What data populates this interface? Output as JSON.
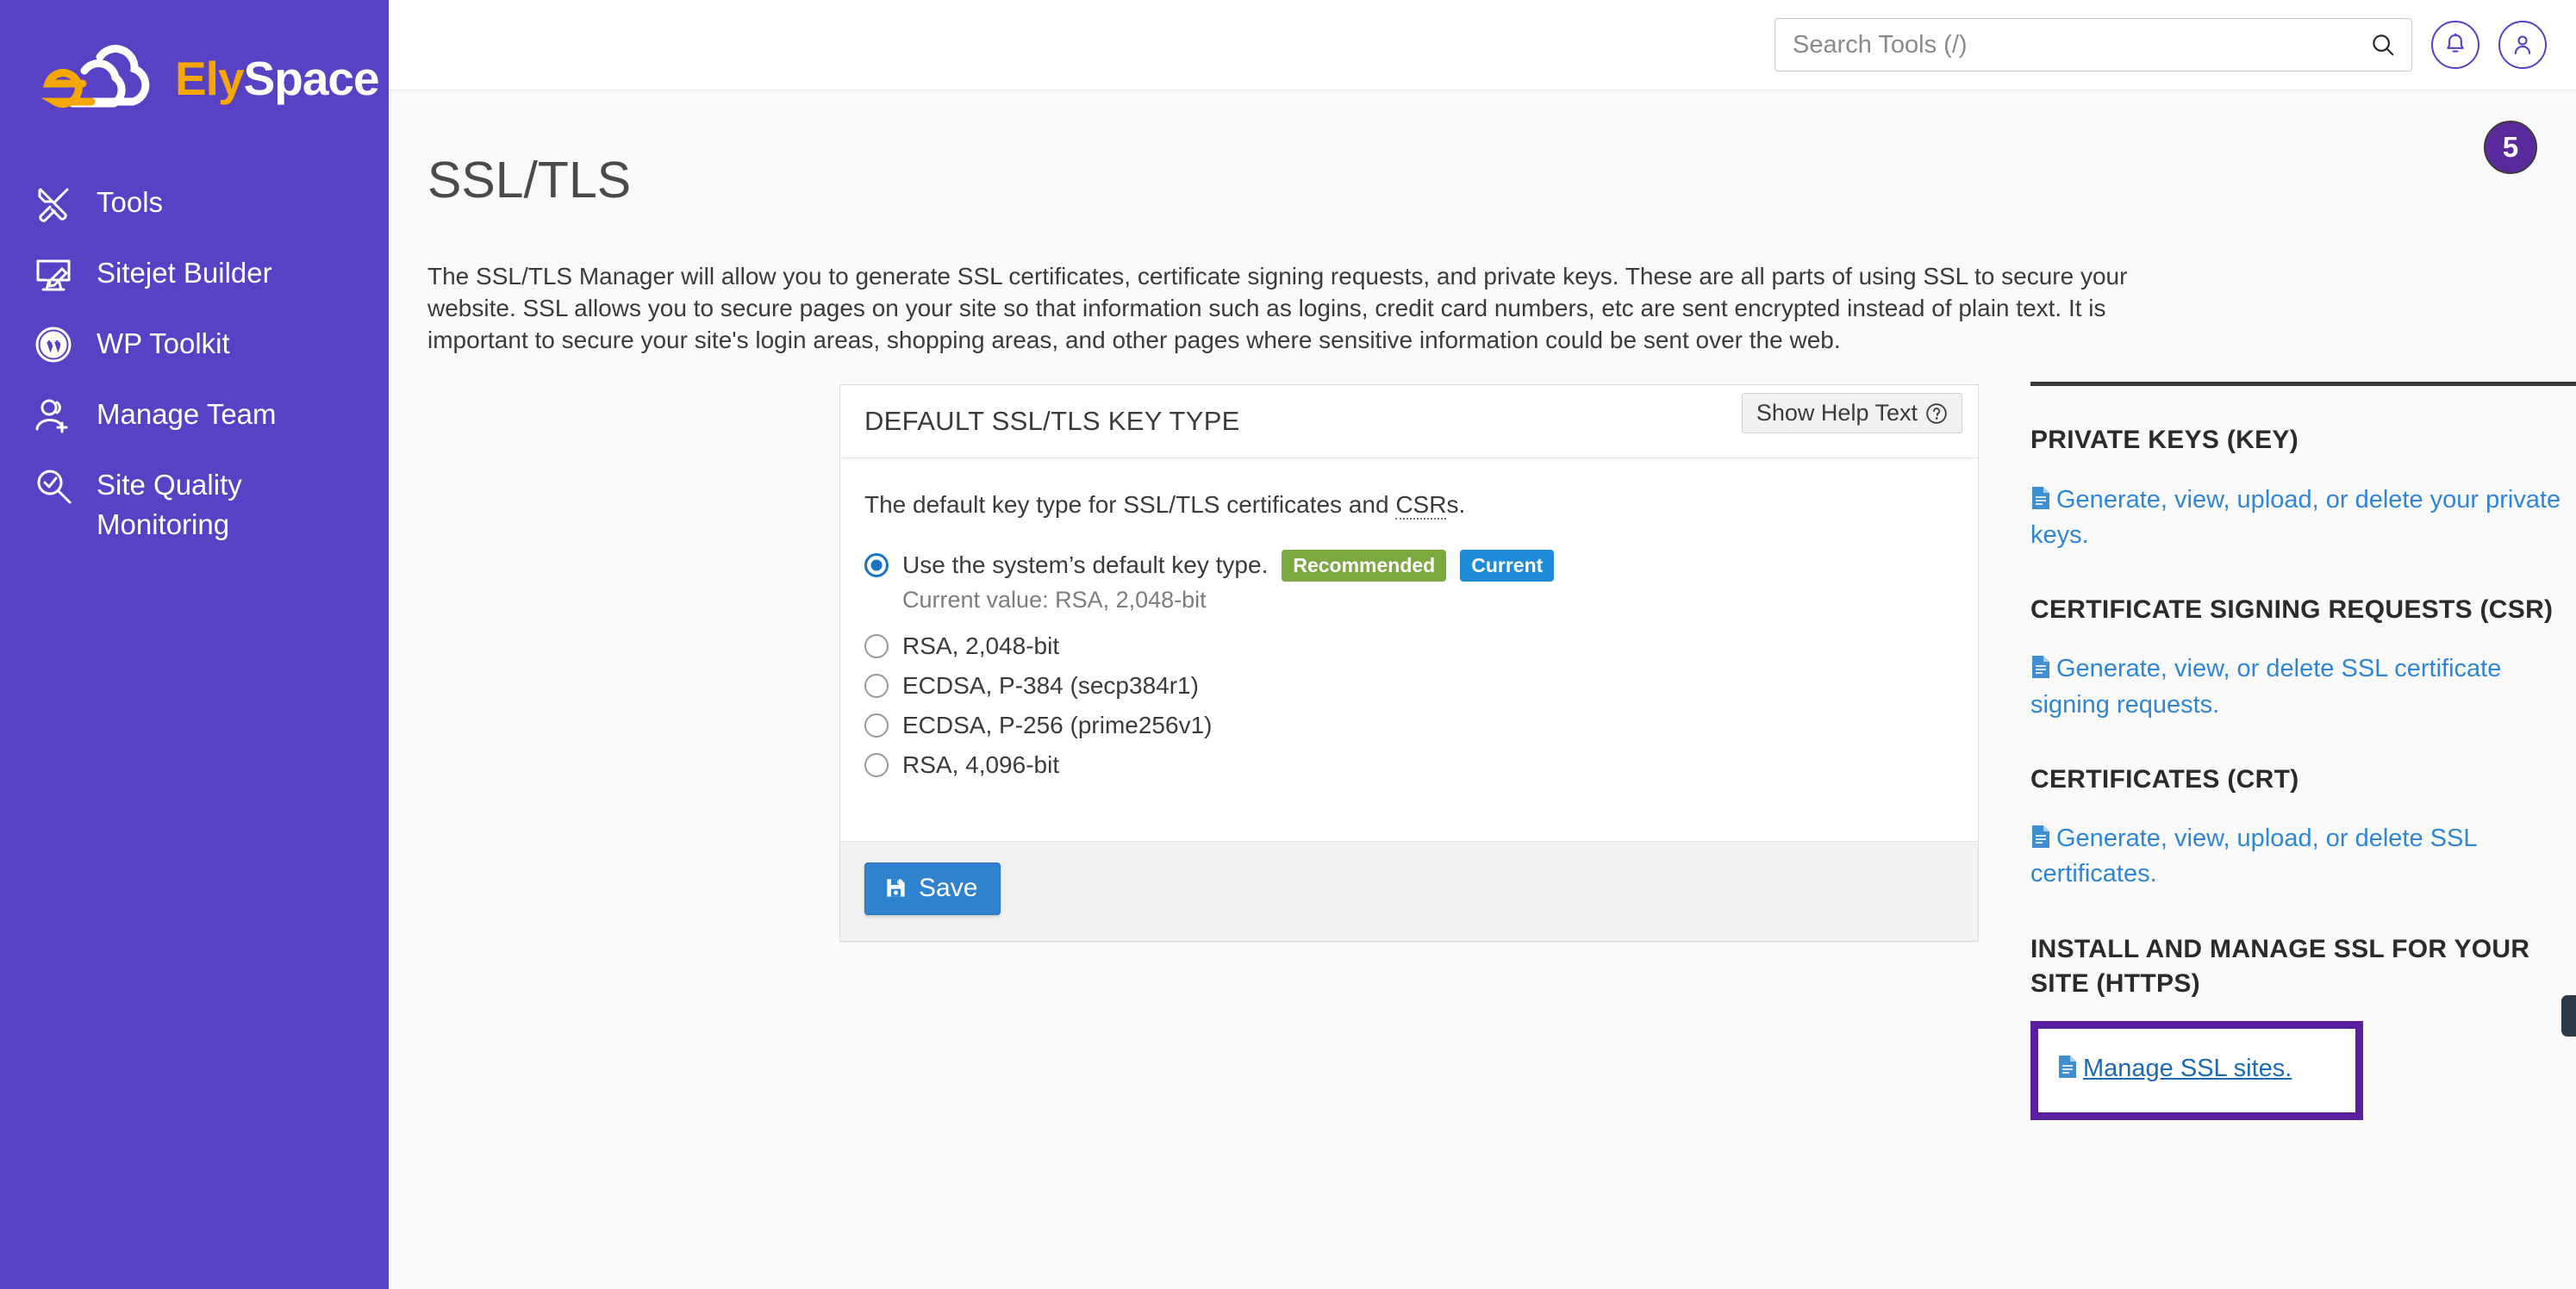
{
  "sidebar": {
    "logo": {
      "part1": "Ely",
      "part2": "Space",
      "icon": "elyspace-cloud-logo"
    },
    "items": [
      {
        "label": "Tools",
        "icon": "tools-icon"
      },
      {
        "label": "Sitejet Builder",
        "icon": "monitor-pencil-icon"
      },
      {
        "label": "WP Toolkit",
        "icon": "wordpress-icon"
      },
      {
        "label": "Manage Team",
        "icon": "user-plus-icon"
      },
      {
        "label": "Site Quality Monitoring",
        "icon": "magnifier-check-icon"
      }
    ]
  },
  "topbar": {
    "search": {
      "placeholder": "Search Tools (/)",
      "value": "",
      "icon": "search-icon"
    },
    "notifications_icon": "bell-icon",
    "account_icon": "user-avatar-icon",
    "step_badge": "5"
  },
  "page": {
    "title": "SSL/TLS",
    "description": "The SSL/TLS Manager will allow you to generate SSL certificates, certificate signing requests, and private keys. These are all parts of using SSL to secure your website. SSL allows you to secure pages on your site so that information such as logins, credit card numbers, etc are sent encrypted instead of plain text. It is important to secure your site's login areas, shopping areas, and other pages where sensitive information could be sent over the web."
  },
  "card": {
    "title": "DEFAULT SSL/TLS KEY TYPE",
    "help_button": {
      "label": "Show Help Text",
      "icon": "question-circle-icon"
    },
    "field_description_pre": "The default key type for SSL/TLS certificates and ",
    "field_description_abbr": "CSR",
    "field_description_post": "s.",
    "options": [
      {
        "label": "Use the system’s default key type.",
        "selected": true,
        "tags": [
          {
            "text": "Recommended",
            "color": "#7ba93f"
          },
          {
            "text": "Current",
            "color": "#1f8ad6"
          }
        ],
        "sublabel": "Current value: RSA, 2,048-bit"
      },
      {
        "label": "RSA, 2,048-bit",
        "selected": false,
        "tags": [],
        "sublabel": ""
      },
      {
        "label": "ECDSA, P-384 (secp384r1)",
        "selected": false,
        "tags": [],
        "sublabel": ""
      },
      {
        "label": "ECDSA, P-256 (prime256v1)",
        "selected": false,
        "tags": [],
        "sublabel": ""
      },
      {
        "label": "RSA, 4,096-bit",
        "selected": false,
        "tags": [],
        "sublabel": ""
      }
    ],
    "save_button": {
      "label": "Save",
      "icon": "floppy-disk-icon",
      "color": "#2f82cd"
    }
  },
  "rightpanel": {
    "sections": [
      {
        "heading": "PRIVATE KEYS (KEY)",
        "link": "Generate, view, upload, or delete your private keys.",
        "icon": "document-icon",
        "highlighted": false
      },
      {
        "heading": "CERTIFICATE SIGNING REQUESTS (CSR)",
        "link": "Generate, view, or delete SSL certificate signing requests.",
        "icon": "document-icon",
        "highlighted": false
      },
      {
        "heading": "CERTIFICATES (CRT)",
        "link": "Generate, view, upload, or delete SSL certificates.",
        "icon": "document-icon",
        "highlighted": false
      },
      {
        "heading": "INSTALL AND MANAGE SSL FOR YOUR SITE (HTTPS)",
        "link": "Manage SSL sites.",
        "icon": "document-icon",
        "highlighted": true
      }
    ]
  },
  "annotation": {
    "highlight_color": "#5a1f9e",
    "arrow": "left-arrow-annotation"
  },
  "colors": {
    "sidebar_bg": "#5841c4",
    "accent_orange": "#f5a700",
    "link_blue": "#2f86d4",
    "button_blue": "#2f82cd"
  }
}
